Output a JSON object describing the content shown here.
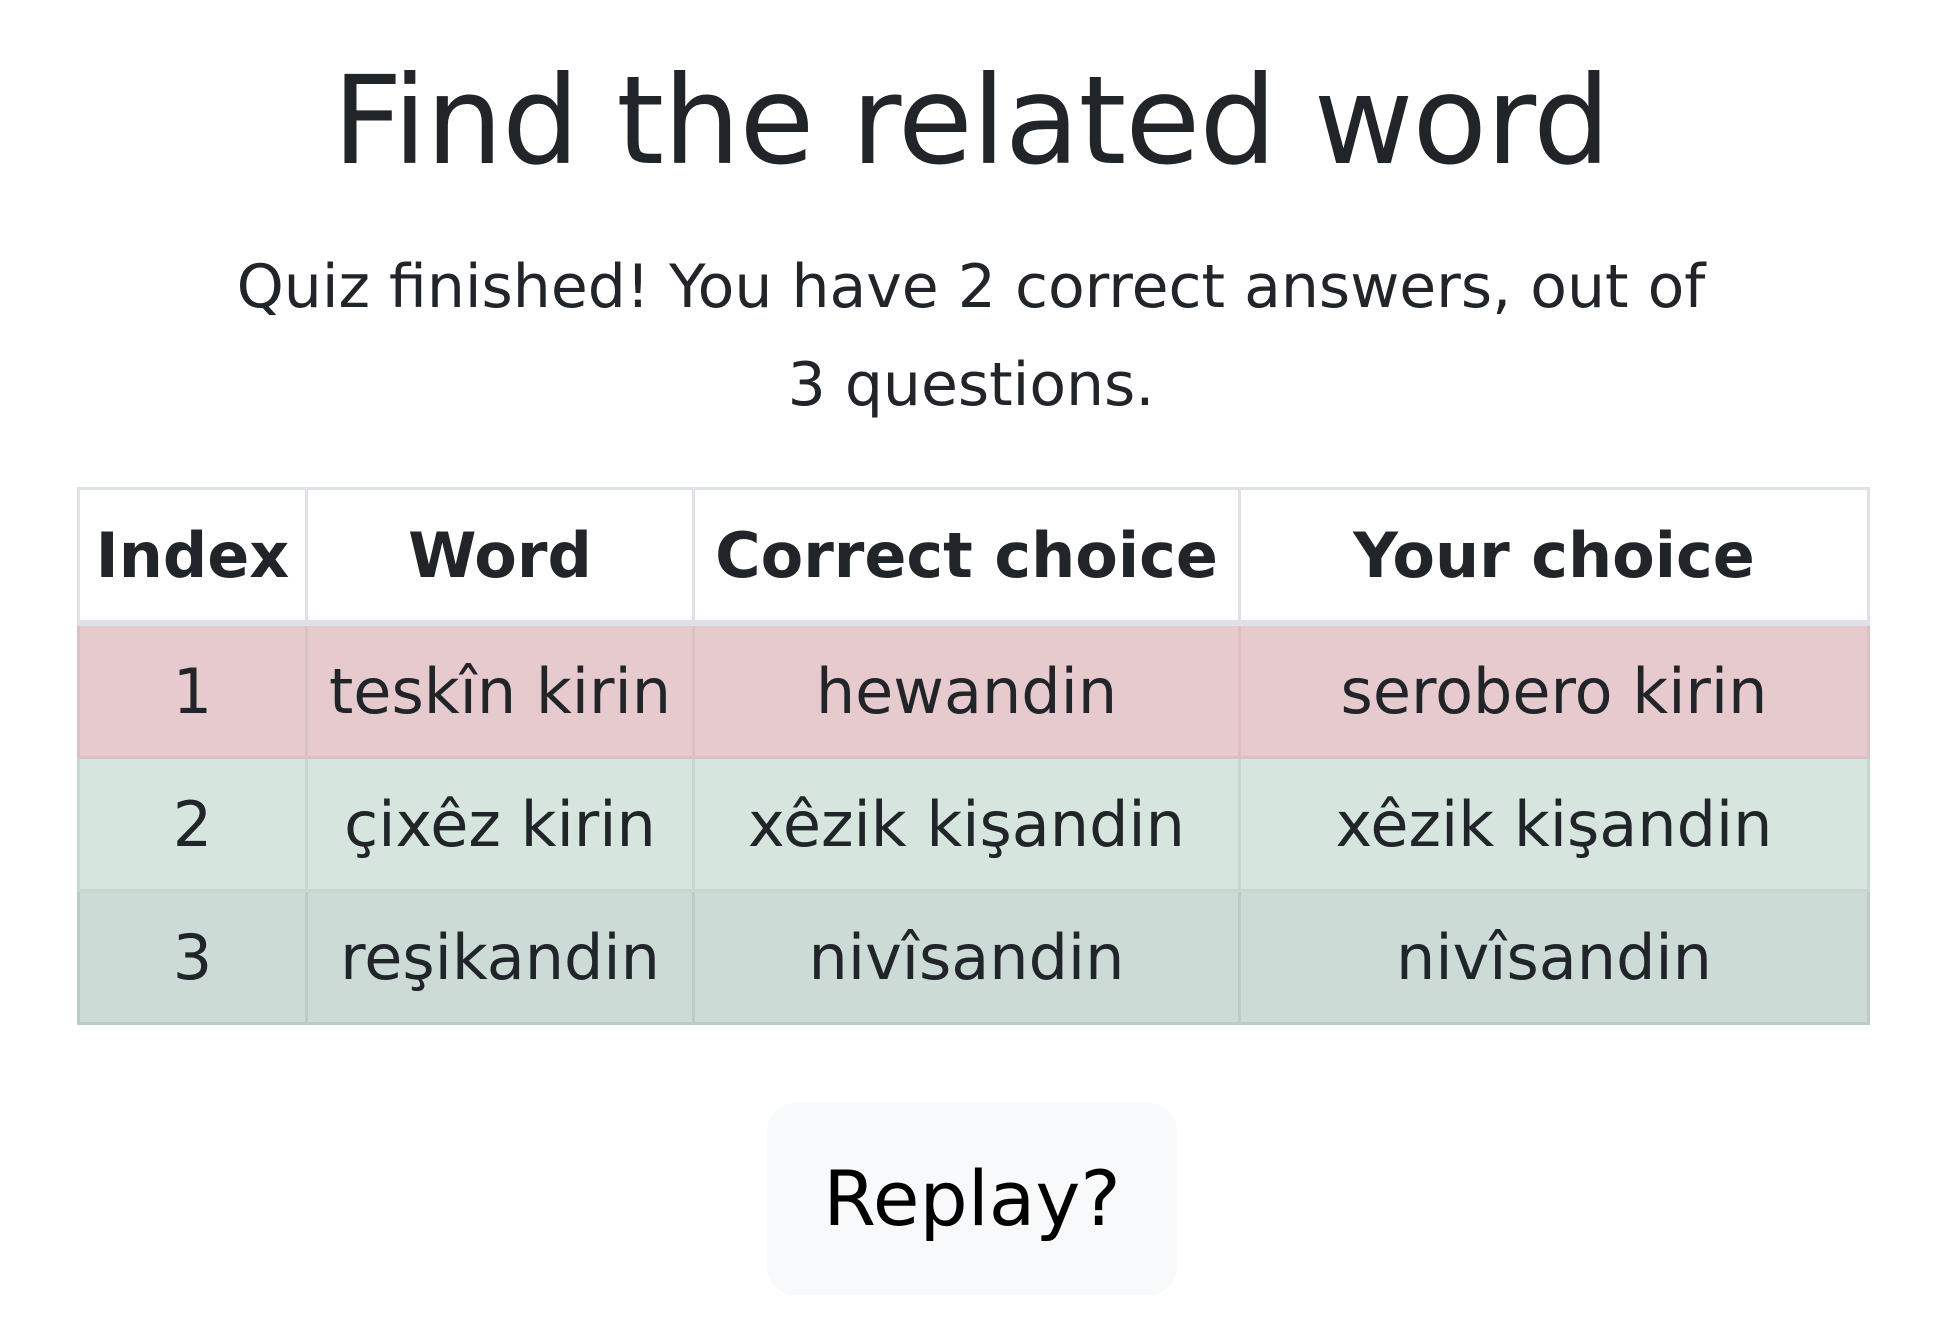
{
  "header": {
    "title": "Find the related word"
  },
  "summary": {
    "text": "Quiz finished! You have 2 correct answers, out of 3 questions."
  },
  "results_table": {
    "columns": [
      "Index",
      "Word",
      "Correct choice",
      "Your choice"
    ],
    "rows": [
      {
        "index": "1",
        "word": "teskîn kirin",
        "correct_choice": "hewandin",
        "your_choice": "serobero kirin",
        "status": "incorrect"
      },
      {
        "index": "2",
        "word": "çixêz kirin",
        "correct_choice": "xêzik kişandin",
        "your_choice": "xêzik kişandin",
        "status": "correct"
      },
      {
        "index": "3",
        "word": "reşikandin",
        "correct_choice": "nivîsandin",
        "your_choice": "nivîsandin",
        "status": "correct"
      }
    ]
  },
  "actions": {
    "replay_label": "Replay?"
  },
  "colors": {
    "text": "#212529",
    "incorrect_row": "#e7cacd",
    "correct_row": "#d6e6de",
    "correct_row_alt": "#ccdbd5",
    "table_border": "#dee2e6",
    "button_bg": "#f8f9fa"
  }
}
